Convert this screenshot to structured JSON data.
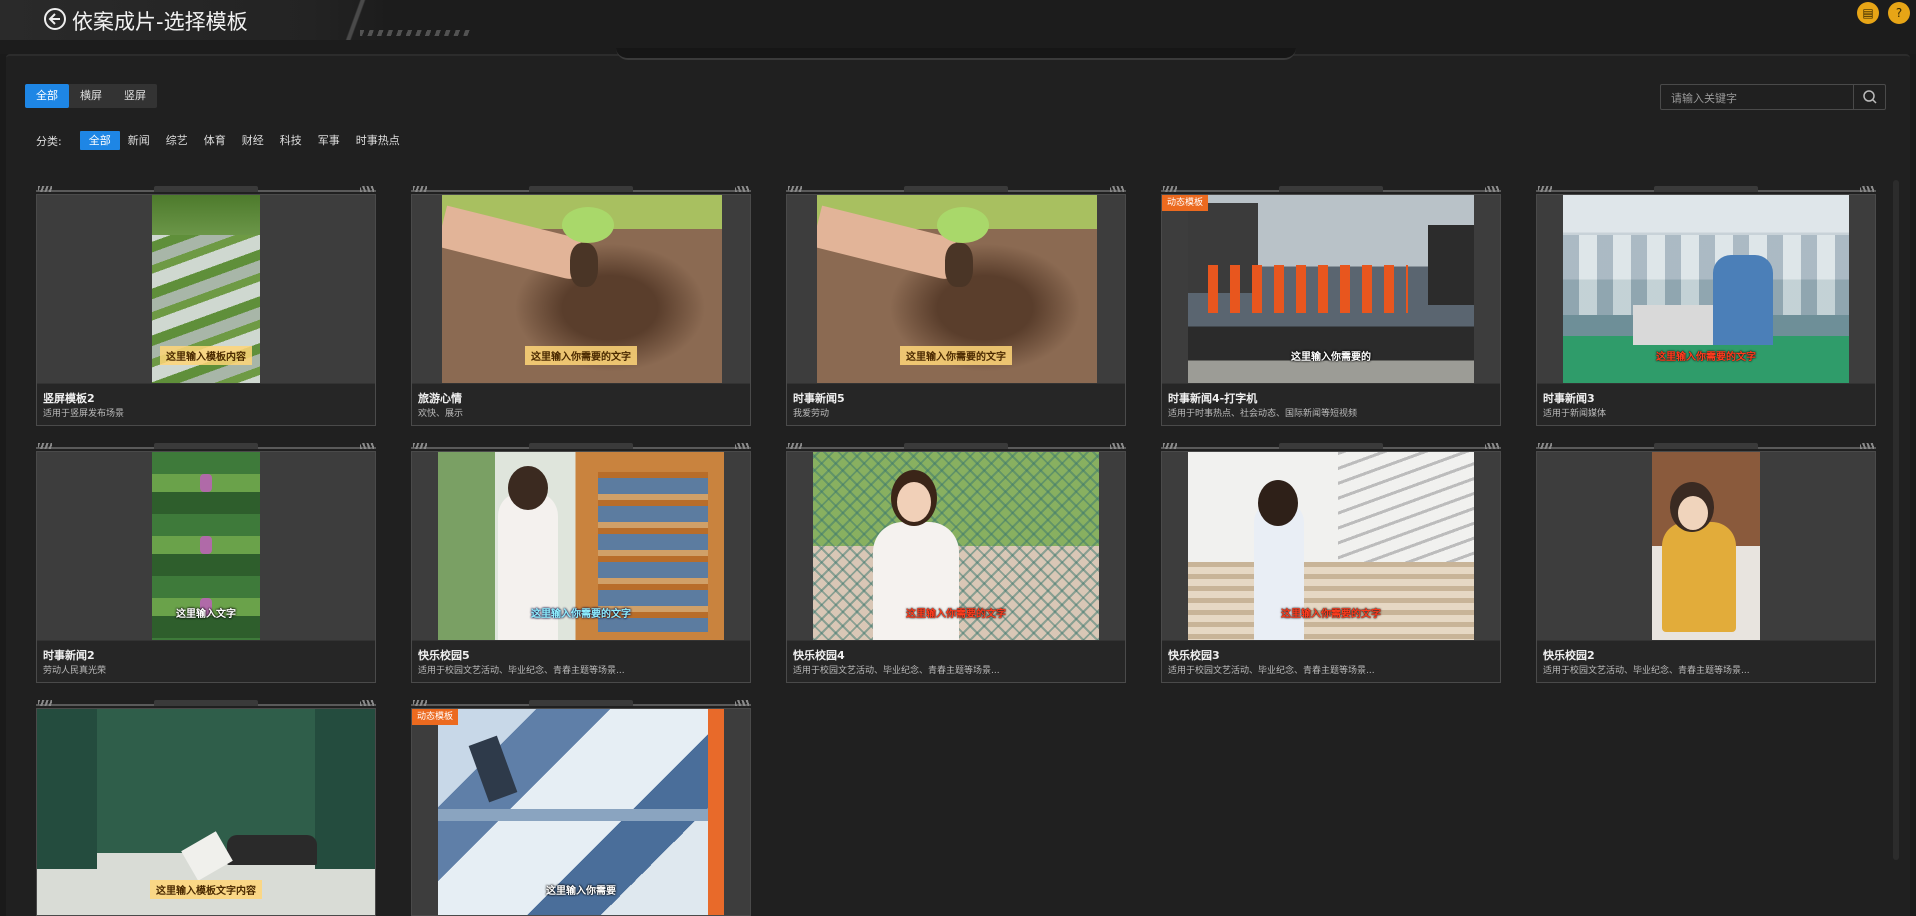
{
  "header": {
    "title": "依案成片-选择模板",
    "right_icons": [
      {
        "name": "notice-icon",
        "glyph": "▤",
        "color": "#e7a516"
      },
      {
        "name": "help-icon",
        "glyph": "?",
        "color": "#e7a516"
      }
    ]
  },
  "type_tabs": [
    {
      "label": "全部",
      "active": true
    },
    {
      "label": "横屏",
      "active": false
    },
    {
      "label": "竖屏",
      "active": false
    }
  ],
  "search": {
    "placeholder": "请输入关键字"
  },
  "category": {
    "label": "分类:",
    "items": [
      {
        "label": "全部",
        "active": true
      },
      {
        "label": "新闻",
        "active": false
      },
      {
        "label": "综艺",
        "active": false
      },
      {
        "label": "体育",
        "active": false
      },
      {
        "label": "财经",
        "active": false
      },
      {
        "label": "科技",
        "active": false
      },
      {
        "label": "军事",
        "active": false
      },
      {
        "label": "时事热点",
        "active": false
      }
    ]
  },
  "templates": [
    {
      "name": "竖屏模板2",
      "desc": "适用于竖屏发布场景",
      "orientation": "vertical",
      "scene": "rice-terraces",
      "caption": "这里输入模板内容",
      "caption_style": "yellow",
      "badge": ""
    },
    {
      "name": "旅游心情",
      "desc": "欢快、展示",
      "orientation": "horizontal",
      "scene": "seedling",
      "caption": "这里输入你需要的文字",
      "caption_style": "yellow",
      "badge": ""
    },
    {
      "name": "时事新闻5",
      "desc": "我爱劳动",
      "orientation": "horizontal",
      "scene": "seedling",
      "caption": "这里输入你需要的文字",
      "caption_style": "yellow",
      "badge": ""
    },
    {
      "name": "时事新闻4-打字机",
      "desc": "适用于时事热点、社会动态、国际新闻等短视频",
      "orientation": "horizontal",
      "scene": "road-workers",
      "caption": "这里输入你需要的",
      "caption_style": "white",
      "badge": "动态模板"
    },
    {
      "name": "时事新闻3",
      "desc": "适用于新闻媒体",
      "orientation": "horizontal",
      "scene": "factory",
      "caption": "这里输入你需要的文字",
      "caption_style": "red",
      "badge": ""
    },
    {
      "name": "时事新闻2",
      "desc": "劳动人民真光荣",
      "orientation": "vertical",
      "scene": "tea-field",
      "caption": "这里输入文字",
      "caption_style": "white",
      "badge": ""
    },
    {
      "name": "快乐校园5",
      "desc": "适用于校园文艺活动、毕业纪念、青春主题等场景...",
      "orientation": "horizontal",
      "scene": "library",
      "caption": "这里输入你需要的文字",
      "caption_style": "cyan",
      "badge": ""
    },
    {
      "name": "快乐校园4",
      "desc": "适用于校园文艺活动、毕业纪念、青春主题等场景...",
      "orientation": "horizontal",
      "scene": "fence-girl",
      "caption": "这里输入你需要的文字",
      "caption_style": "red",
      "badge": ""
    },
    {
      "name": "快乐校园3",
      "desc": "适用于校园文艺活动、毕业纪念、青春主题等场景...",
      "orientation": "horizontal",
      "scene": "stairs",
      "caption": "这里输入你需要的文字",
      "caption_style": "red",
      "badge": ""
    },
    {
      "name": "快乐校园2",
      "desc": "适用于校园文艺活动、毕业纪念、青春主题等场景...",
      "orientation": "vertical",
      "scene": "yellow-girl",
      "caption": "",
      "caption_style": "none",
      "badge": ""
    },
    {
      "name": "",
      "desc": "",
      "orientation": "horizontal",
      "scene": "chalkboard",
      "caption": "这里输入模板文字内容",
      "caption_style": "yellow",
      "badge": ""
    },
    {
      "name": "",
      "desc": "",
      "orientation": "horizontal",
      "scene": "machinery",
      "caption": "这里输入你需要",
      "caption_style": "white",
      "badge": "动态模板"
    }
  ]
}
